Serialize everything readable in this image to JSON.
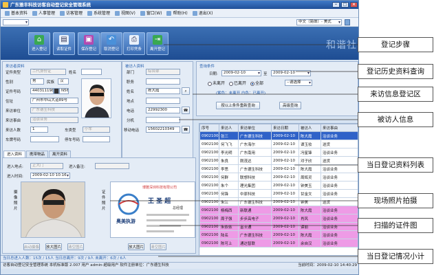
{
  "window": {
    "title": "广东雅丰科技访客自动登记安全管理系统"
  },
  "menu": [
    "基本资料",
    "人事管理",
    "访客管理",
    "系统管理",
    "视图(V)",
    "窗口(W)",
    "帮助(H)",
    "退出(X)"
  ],
  "lang_select": "中文（简体）- 美式",
  "toolbar": {
    "buttons": [
      {
        "label": "进入登记"
      },
      {
        "label": "读取证件"
      },
      {
        "label": "保存登记"
      },
      {
        "label": "取消登记"
      },
      {
        "label": "打印凭条"
      },
      {
        "label": "离开登记"
      }
    ],
    "banner": "和谐社"
  },
  "visitor": {
    "title": "来访者资料",
    "id_type_label": "证件类型",
    "id_type": "二代身份证",
    "name_label": "姓名",
    "gender_label": "性别",
    "gender": "男",
    "ethnic_label": "民族",
    "ethnic": "汉",
    "id_no_label": "证件号码",
    "id_no": "440311198",
    "id_no_tail": "N56",
    "address_label": "住址",
    "address": "广州市中山大道89号",
    "unit_label": "来访单位",
    "unit": "广东德生科技",
    "reason_label": "来访事由",
    "reason": "洽谈业务",
    "count_label": "来访人数",
    "count": "1",
    "car_type_label": "车类型",
    "car_type": "小车",
    "car_no_label": "车牌号码",
    "park_label": "停车号码"
  },
  "visited": {
    "title": "被访人资料",
    "dept_label": "部门",
    "dept": "综合部",
    "job_label": "职务",
    "name_label": "姓名",
    "name": "陈大霞",
    "location_label": "地点",
    "phone_label": "电话",
    "phone": "22992300",
    "ext_label": "分机",
    "mobile_label": "移动电话",
    "mobile": "15602210349"
  },
  "query": {
    "title": "查询条件",
    "date_label": "日期:",
    "date_from": "2009-02-10",
    "to_label": "至",
    "date_to": "2009-02-10",
    "radios": [
      {
        "label": "未离开",
        "checked": false
      },
      {
        "label": "已离开",
        "checked": false
      },
      {
        "label": "全部",
        "checked": true
      }
    ],
    "select_placeholder": "--请选择",
    "legend": "(紫色：未离开    白色：已离开)",
    "query_button": "按以上条件重新查询",
    "advanced_button": "高级查询"
  },
  "records": {
    "columns": [
      "序号",
      "来访人",
      "来访单位",
      "来访日期",
      "被访人",
      "来访事由"
    ],
    "rows": [
      {
        "no": "090210001",
        "visitor": "张三",
        "unit": "广东德生科技",
        "date": "2009-02-10",
        "host": "陈大霞",
        "reason": "洽谈业务",
        "state": "sel"
      },
      {
        "no": "090210002",
        "visitor": "何飞飞",
        "unit": "广东海尔",
        "date": "2009-02-10",
        "host": "谭玉妆",
        "reason": "送货",
        "state": ""
      },
      {
        "no": "090210003",
        "visitor": "李光明",
        "unit": "广东南用",
        "date": "2009-02-10",
        "host": "冯星锋",
        "reason": "洽谈业务",
        "state": ""
      },
      {
        "no": "090210004",
        "visitor": "朱良",
        "unit": "刚茂达",
        "date": "2009-02-10",
        "host": "邓子欣",
        "reason": "送货",
        "state": ""
      },
      {
        "no": "090210005",
        "visitor": "李思",
        "unit": "广东德生科技",
        "date": "2009-02-10",
        "host": "陈大霞",
        "reason": "洽谈业务",
        "state": ""
      },
      {
        "no": "090210006",
        "visitor": "何群",
        "unit": "联想科技",
        "date": "2009-02-10",
        "host": "周辉灵",
        "reason": "洽谈业务",
        "state": ""
      },
      {
        "no": "090210007",
        "visitor": "朱个",
        "unit": "理光集团",
        "date": "2009-02-10",
        "host": "钟美玉",
        "reason": "洽谈业务",
        "state": ""
      },
      {
        "no": "090210008",
        "visitor": "何锋",
        "unit": "中原科技",
        "date": "2009-02-10",
        "host": "甘金文",
        "reason": "洽谈业务",
        "state": ""
      },
      {
        "no": "090210009",
        "visitor": "朱江",
        "unit": "广东德生科技",
        "date": "2009-02-10",
        "host": "钟美",
        "reason": "送货",
        "state": ""
      },
      {
        "no": "090210010",
        "visitor": "杨梅西",
        "unit": "新联通",
        "date": "2009-02-10",
        "host": "陈大霞",
        "reason": "洽谈业务",
        "state": "pink"
      },
      {
        "no": "090210011",
        "visitor": "周子强",
        "unit": "步步高电子",
        "date": "2009-02-10",
        "host": "肖风",
        "reason": "洽谈业务",
        "state": "pink"
      },
      {
        "no": "090210012",
        "visitor": "朱依依",
        "unit": "富士通",
        "date": "2009-02-10",
        "host": "谭丽",
        "reason": "洽谈业务",
        "state": "pink"
      },
      {
        "no": "090210013",
        "visitor": "陆名",
        "unit": "广东德生科技",
        "date": "2009-02-10",
        "host": "陈大霞",
        "reason": "洽谈业务",
        "state": "pink"
      },
      {
        "no": "090210014",
        "visitor": "陈可上",
        "unit": "通达智联",
        "date": "2009-02-10",
        "host": "余自汉",
        "reason": "洽谈业务",
        "state": "pink"
      }
    ]
  },
  "entry": {
    "tabs": [
      "进入资料",
      "携带物品",
      "离开资料"
    ],
    "place_label": "进入地点:",
    "place": "正大门",
    "remark_label": "进入备注:",
    "time_label": "进入时间:",
    "time": "2009-02-10 10:16",
    "camera_label": "摄像照片",
    "id_photo_label": "证件照片",
    "start_cam_button": "启动摄像",
    "enlarge_button": "放大图片",
    "clear_button": "清空图片",
    "enlarge_button2": "放大图片",
    "clear_button2": "清空图片",
    "card": {
      "company": "博雅深圳科技有限公司",
      "brand": "奥美执游",
      "name": "王 圣 超",
      "title": "总经理"
    }
  },
  "summary": "当日总进入人数：15次 / 15人  当日总离开：9次 / 9人  未离开：6次 / 6人",
  "status": {
    "left": "访客自动登记安全管理系统  本机标准版 2.007  用户 admin-超级用户  软件注册单位：广东德生科技",
    "right": "当前时间：2009-02-10 14:40:29"
  },
  "callouts": [
    "登记步骤",
    "登记历史资料查询",
    "来访信息登记区",
    "被访人信息",
    "当日登记资料列表",
    "现场照片拍摄",
    "扫描的证件图",
    "当日登记情况小计"
  ]
}
